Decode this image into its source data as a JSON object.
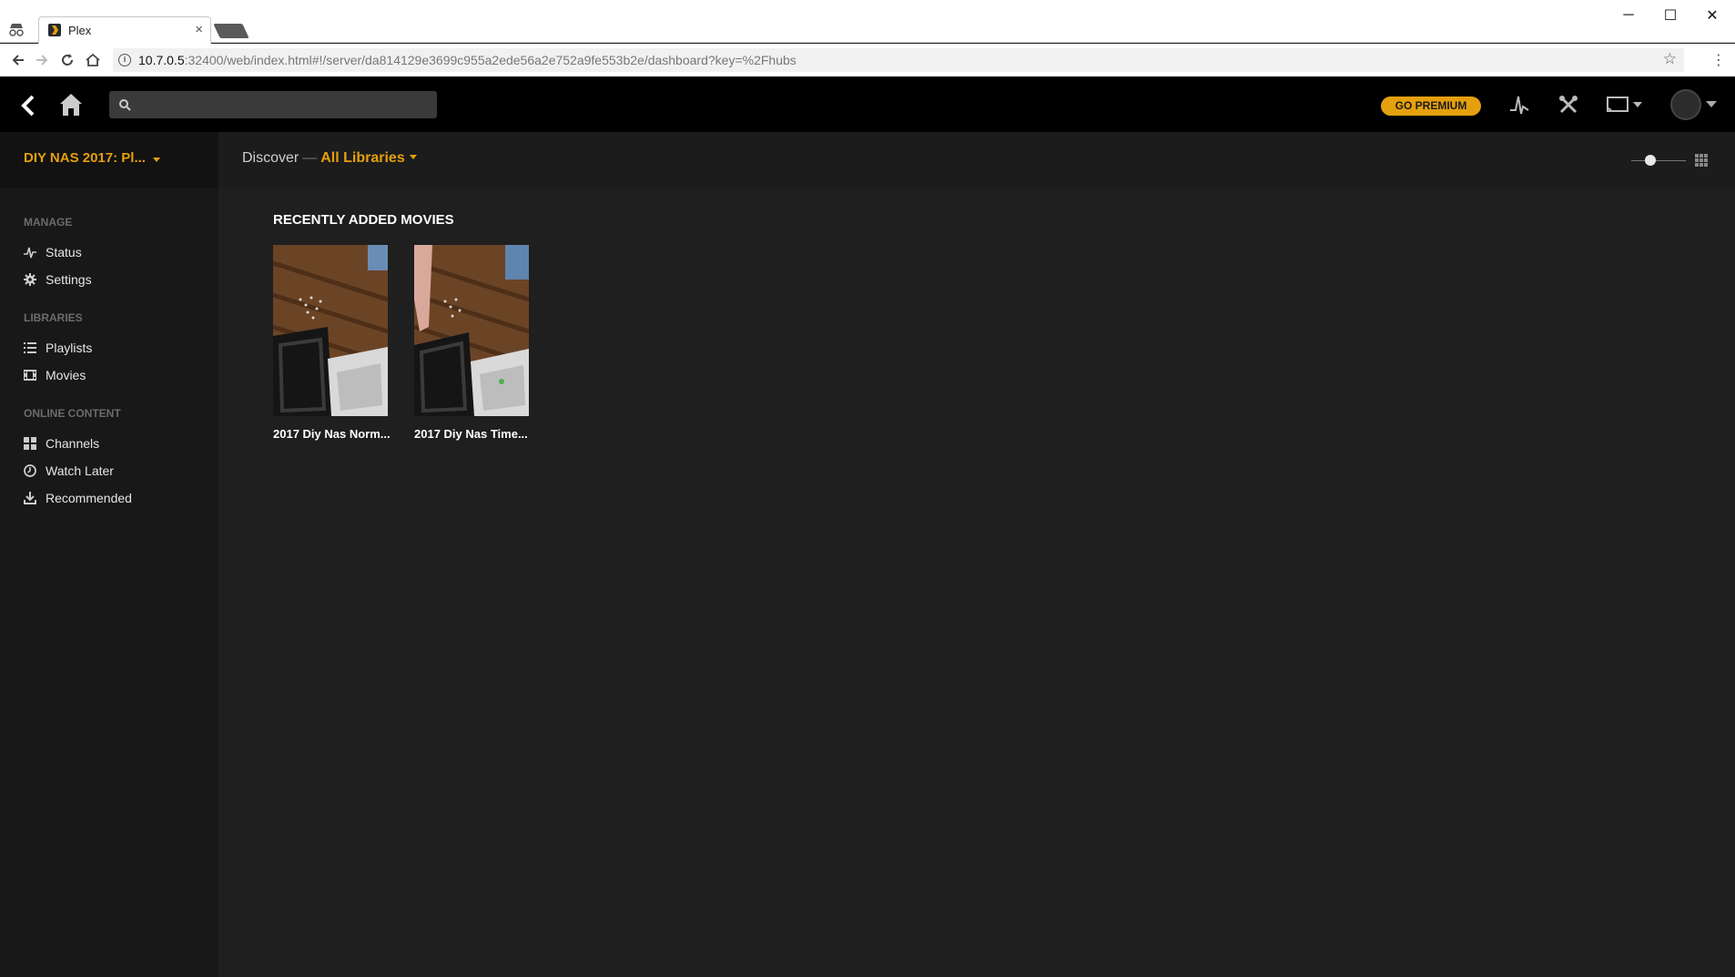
{
  "browser": {
    "tab_title": "Plex",
    "tab_close": "×",
    "url_host": "10.7.0.5",
    "url_rest": ":32400/web/index.html#!/server/da814129e3699c955a2ede56a2e752a9fe553b2e/dashboard?key=%2Fhubs",
    "window_controls": {
      "minimize": "─",
      "maximize": "☐",
      "close": "✕"
    }
  },
  "topbar": {
    "search_placeholder": "",
    "premium_label": "GO PREMIUM"
  },
  "sidebar": {
    "server_name": "DIY NAS 2017: Pl...",
    "sections": [
      {
        "label": "MANAGE",
        "items": [
          {
            "label": "Status",
            "icon": "activity-icon"
          },
          {
            "label": "Settings",
            "icon": "gear-icon"
          }
        ]
      },
      {
        "label": "LIBRARIES",
        "items": [
          {
            "label": "Playlists",
            "icon": "list-icon"
          },
          {
            "label": "Movies",
            "icon": "film-icon"
          }
        ]
      },
      {
        "label": "ONLINE CONTENT",
        "items": [
          {
            "label": "Channels",
            "icon": "grid-icon"
          },
          {
            "label": "Watch Later",
            "icon": "clock-icon"
          },
          {
            "label": "Recommended",
            "icon": "download-icon"
          }
        ]
      }
    ]
  },
  "header": {
    "discover": "Discover",
    "separator": "—",
    "library": "All Libraries"
  },
  "hub": {
    "title": "RECENTLY ADDED MOVIES",
    "items": [
      {
        "title": "2017 Diy Nas Norm..."
      },
      {
        "title": "2017 Diy Nas Time..."
      }
    ]
  },
  "colors": {
    "accent": "#e5a00d",
    "topbar": "#000000",
    "sidebar": "#181818",
    "main": "#1f1f1f"
  }
}
